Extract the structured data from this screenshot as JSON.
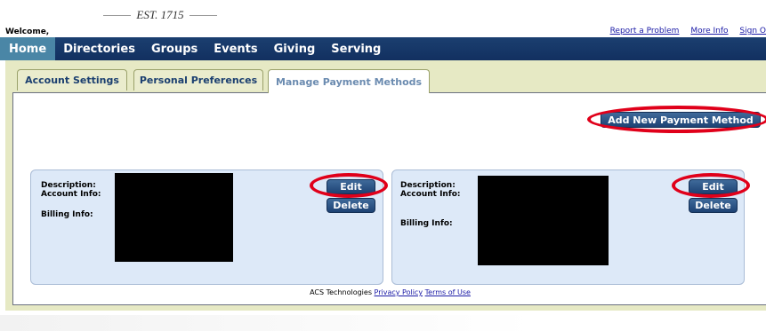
{
  "header": {
    "est": "EST. 1715",
    "welcome": "Welcome,",
    "links": {
      "report": "Report a Problem",
      "more_info": "More Info",
      "sign_out": "Sign O"
    }
  },
  "nav": {
    "items": [
      "Home",
      "Directories",
      "Groups",
      "Events",
      "Giving",
      "Serving"
    ]
  },
  "tabs": [
    "Account Settings",
    "Personal Preferences",
    "Manage Payment Methods"
  ],
  "actions": {
    "add_new": "Add New Payment Method"
  },
  "cards": [
    {
      "description_label": "Description:",
      "account_label": "Account Info:",
      "billing_label": "Billing Info:",
      "edit": "Edit",
      "delete": "Delete"
    },
    {
      "description_label": "Description:",
      "account_label": "Account Info:",
      "billing_label": "Billing Info:",
      "edit": "Edit",
      "delete": "Delete"
    }
  ],
  "footer": {
    "company": "ACS Technologies",
    "privacy": "Privacy Policy",
    "terms": "Terms of Use"
  },
  "colors": {
    "nav_bg": "#1b3f70",
    "home_tab": "#4a86a6",
    "content_bg": "#e6e9c4",
    "card_bg": "#dde9f8",
    "highlight": "#e0001a"
  }
}
